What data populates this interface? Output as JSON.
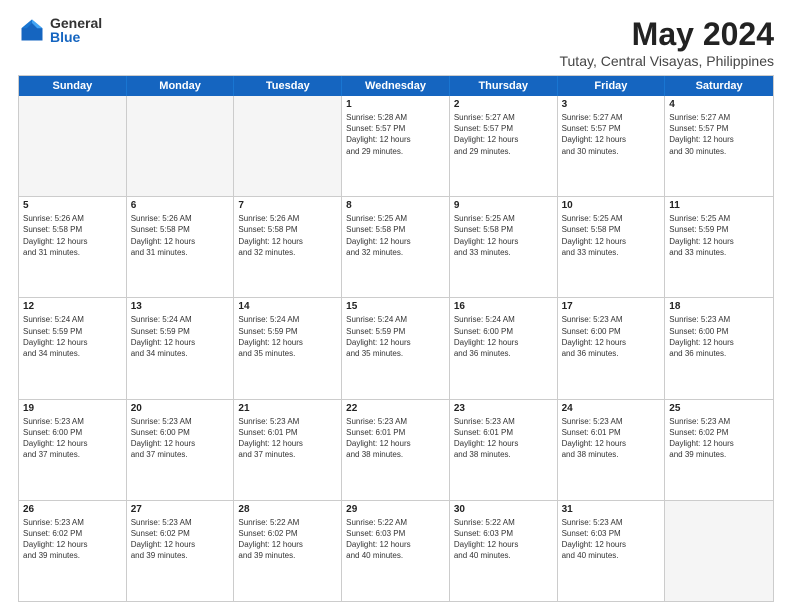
{
  "logo": {
    "general": "General",
    "blue": "Blue"
  },
  "title": "May 2024",
  "subtitle": "Tutay, Central Visayas, Philippines",
  "header_days": [
    "Sunday",
    "Monday",
    "Tuesday",
    "Wednesday",
    "Thursday",
    "Friday",
    "Saturday"
  ],
  "rows": [
    [
      {
        "day": "",
        "info": "",
        "shaded": true
      },
      {
        "day": "",
        "info": "",
        "shaded": true
      },
      {
        "day": "",
        "info": "",
        "shaded": true
      },
      {
        "day": "1",
        "info": "Sunrise: 5:28 AM\nSunset: 5:57 PM\nDaylight: 12 hours\nand 29 minutes.",
        "shaded": false
      },
      {
        "day": "2",
        "info": "Sunrise: 5:27 AM\nSunset: 5:57 PM\nDaylight: 12 hours\nand 29 minutes.",
        "shaded": false
      },
      {
        "day": "3",
        "info": "Sunrise: 5:27 AM\nSunset: 5:57 PM\nDaylight: 12 hours\nand 30 minutes.",
        "shaded": false
      },
      {
        "day": "4",
        "info": "Sunrise: 5:27 AM\nSunset: 5:57 PM\nDaylight: 12 hours\nand 30 minutes.",
        "shaded": false
      }
    ],
    [
      {
        "day": "5",
        "info": "Sunrise: 5:26 AM\nSunset: 5:58 PM\nDaylight: 12 hours\nand 31 minutes.",
        "shaded": false
      },
      {
        "day": "6",
        "info": "Sunrise: 5:26 AM\nSunset: 5:58 PM\nDaylight: 12 hours\nand 31 minutes.",
        "shaded": false
      },
      {
        "day": "7",
        "info": "Sunrise: 5:26 AM\nSunset: 5:58 PM\nDaylight: 12 hours\nand 32 minutes.",
        "shaded": false
      },
      {
        "day": "8",
        "info": "Sunrise: 5:25 AM\nSunset: 5:58 PM\nDaylight: 12 hours\nand 32 minutes.",
        "shaded": false
      },
      {
        "day": "9",
        "info": "Sunrise: 5:25 AM\nSunset: 5:58 PM\nDaylight: 12 hours\nand 33 minutes.",
        "shaded": false
      },
      {
        "day": "10",
        "info": "Sunrise: 5:25 AM\nSunset: 5:58 PM\nDaylight: 12 hours\nand 33 minutes.",
        "shaded": false
      },
      {
        "day": "11",
        "info": "Sunrise: 5:25 AM\nSunset: 5:59 PM\nDaylight: 12 hours\nand 33 minutes.",
        "shaded": false
      }
    ],
    [
      {
        "day": "12",
        "info": "Sunrise: 5:24 AM\nSunset: 5:59 PM\nDaylight: 12 hours\nand 34 minutes.",
        "shaded": false
      },
      {
        "day": "13",
        "info": "Sunrise: 5:24 AM\nSunset: 5:59 PM\nDaylight: 12 hours\nand 34 minutes.",
        "shaded": false
      },
      {
        "day": "14",
        "info": "Sunrise: 5:24 AM\nSunset: 5:59 PM\nDaylight: 12 hours\nand 35 minutes.",
        "shaded": false
      },
      {
        "day": "15",
        "info": "Sunrise: 5:24 AM\nSunset: 5:59 PM\nDaylight: 12 hours\nand 35 minutes.",
        "shaded": false
      },
      {
        "day": "16",
        "info": "Sunrise: 5:24 AM\nSunset: 6:00 PM\nDaylight: 12 hours\nand 36 minutes.",
        "shaded": false
      },
      {
        "day": "17",
        "info": "Sunrise: 5:23 AM\nSunset: 6:00 PM\nDaylight: 12 hours\nand 36 minutes.",
        "shaded": false
      },
      {
        "day": "18",
        "info": "Sunrise: 5:23 AM\nSunset: 6:00 PM\nDaylight: 12 hours\nand 36 minutes.",
        "shaded": false
      }
    ],
    [
      {
        "day": "19",
        "info": "Sunrise: 5:23 AM\nSunset: 6:00 PM\nDaylight: 12 hours\nand 37 minutes.",
        "shaded": false
      },
      {
        "day": "20",
        "info": "Sunrise: 5:23 AM\nSunset: 6:00 PM\nDaylight: 12 hours\nand 37 minutes.",
        "shaded": false
      },
      {
        "day": "21",
        "info": "Sunrise: 5:23 AM\nSunset: 6:01 PM\nDaylight: 12 hours\nand 37 minutes.",
        "shaded": false
      },
      {
        "day": "22",
        "info": "Sunrise: 5:23 AM\nSunset: 6:01 PM\nDaylight: 12 hours\nand 38 minutes.",
        "shaded": false
      },
      {
        "day": "23",
        "info": "Sunrise: 5:23 AM\nSunset: 6:01 PM\nDaylight: 12 hours\nand 38 minutes.",
        "shaded": false
      },
      {
        "day": "24",
        "info": "Sunrise: 5:23 AM\nSunset: 6:01 PM\nDaylight: 12 hours\nand 38 minutes.",
        "shaded": false
      },
      {
        "day": "25",
        "info": "Sunrise: 5:23 AM\nSunset: 6:02 PM\nDaylight: 12 hours\nand 39 minutes.",
        "shaded": false
      }
    ],
    [
      {
        "day": "26",
        "info": "Sunrise: 5:23 AM\nSunset: 6:02 PM\nDaylight: 12 hours\nand 39 minutes.",
        "shaded": false
      },
      {
        "day": "27",
        "info": "Sunrise: 5:23 AM\nSunset: 6:02 PM\nDaylight: 12 hours\nand 39 minutes.",
        "shaded": false
      },
      {
        "day": "28",
        "info": "Sunrise: 5:22 AM\nSunset: 6:02 PM\nDaylight: 12 hours\nand 39 minutes.",
        "shaded": false
      },
      {
        "day": "29",
        "info": "Sunrise: 5:22 AM\nSunset: 6:03 PM\nDaylight: 12 hours\nand 40 minutes.",
        "shaded": false
      },
      {
        "day": "30",
        "info": "Sunrise: 5:22 AM\nSunset: 6:03 PM\nDaylight: 12 hours\nand 40 minutes.",
        "shaded": false
      },
      {
        "day": "31",
        "info": "Sunrise: 5:23 AM\nSunset: 6:03 PM\nDaylight: 12 hours\nand 40 minutes.",
        "shaded": false
      },
      {
        "day": "",
        "info": "",
        "shaded": true
      }
    ]
  ]
}
